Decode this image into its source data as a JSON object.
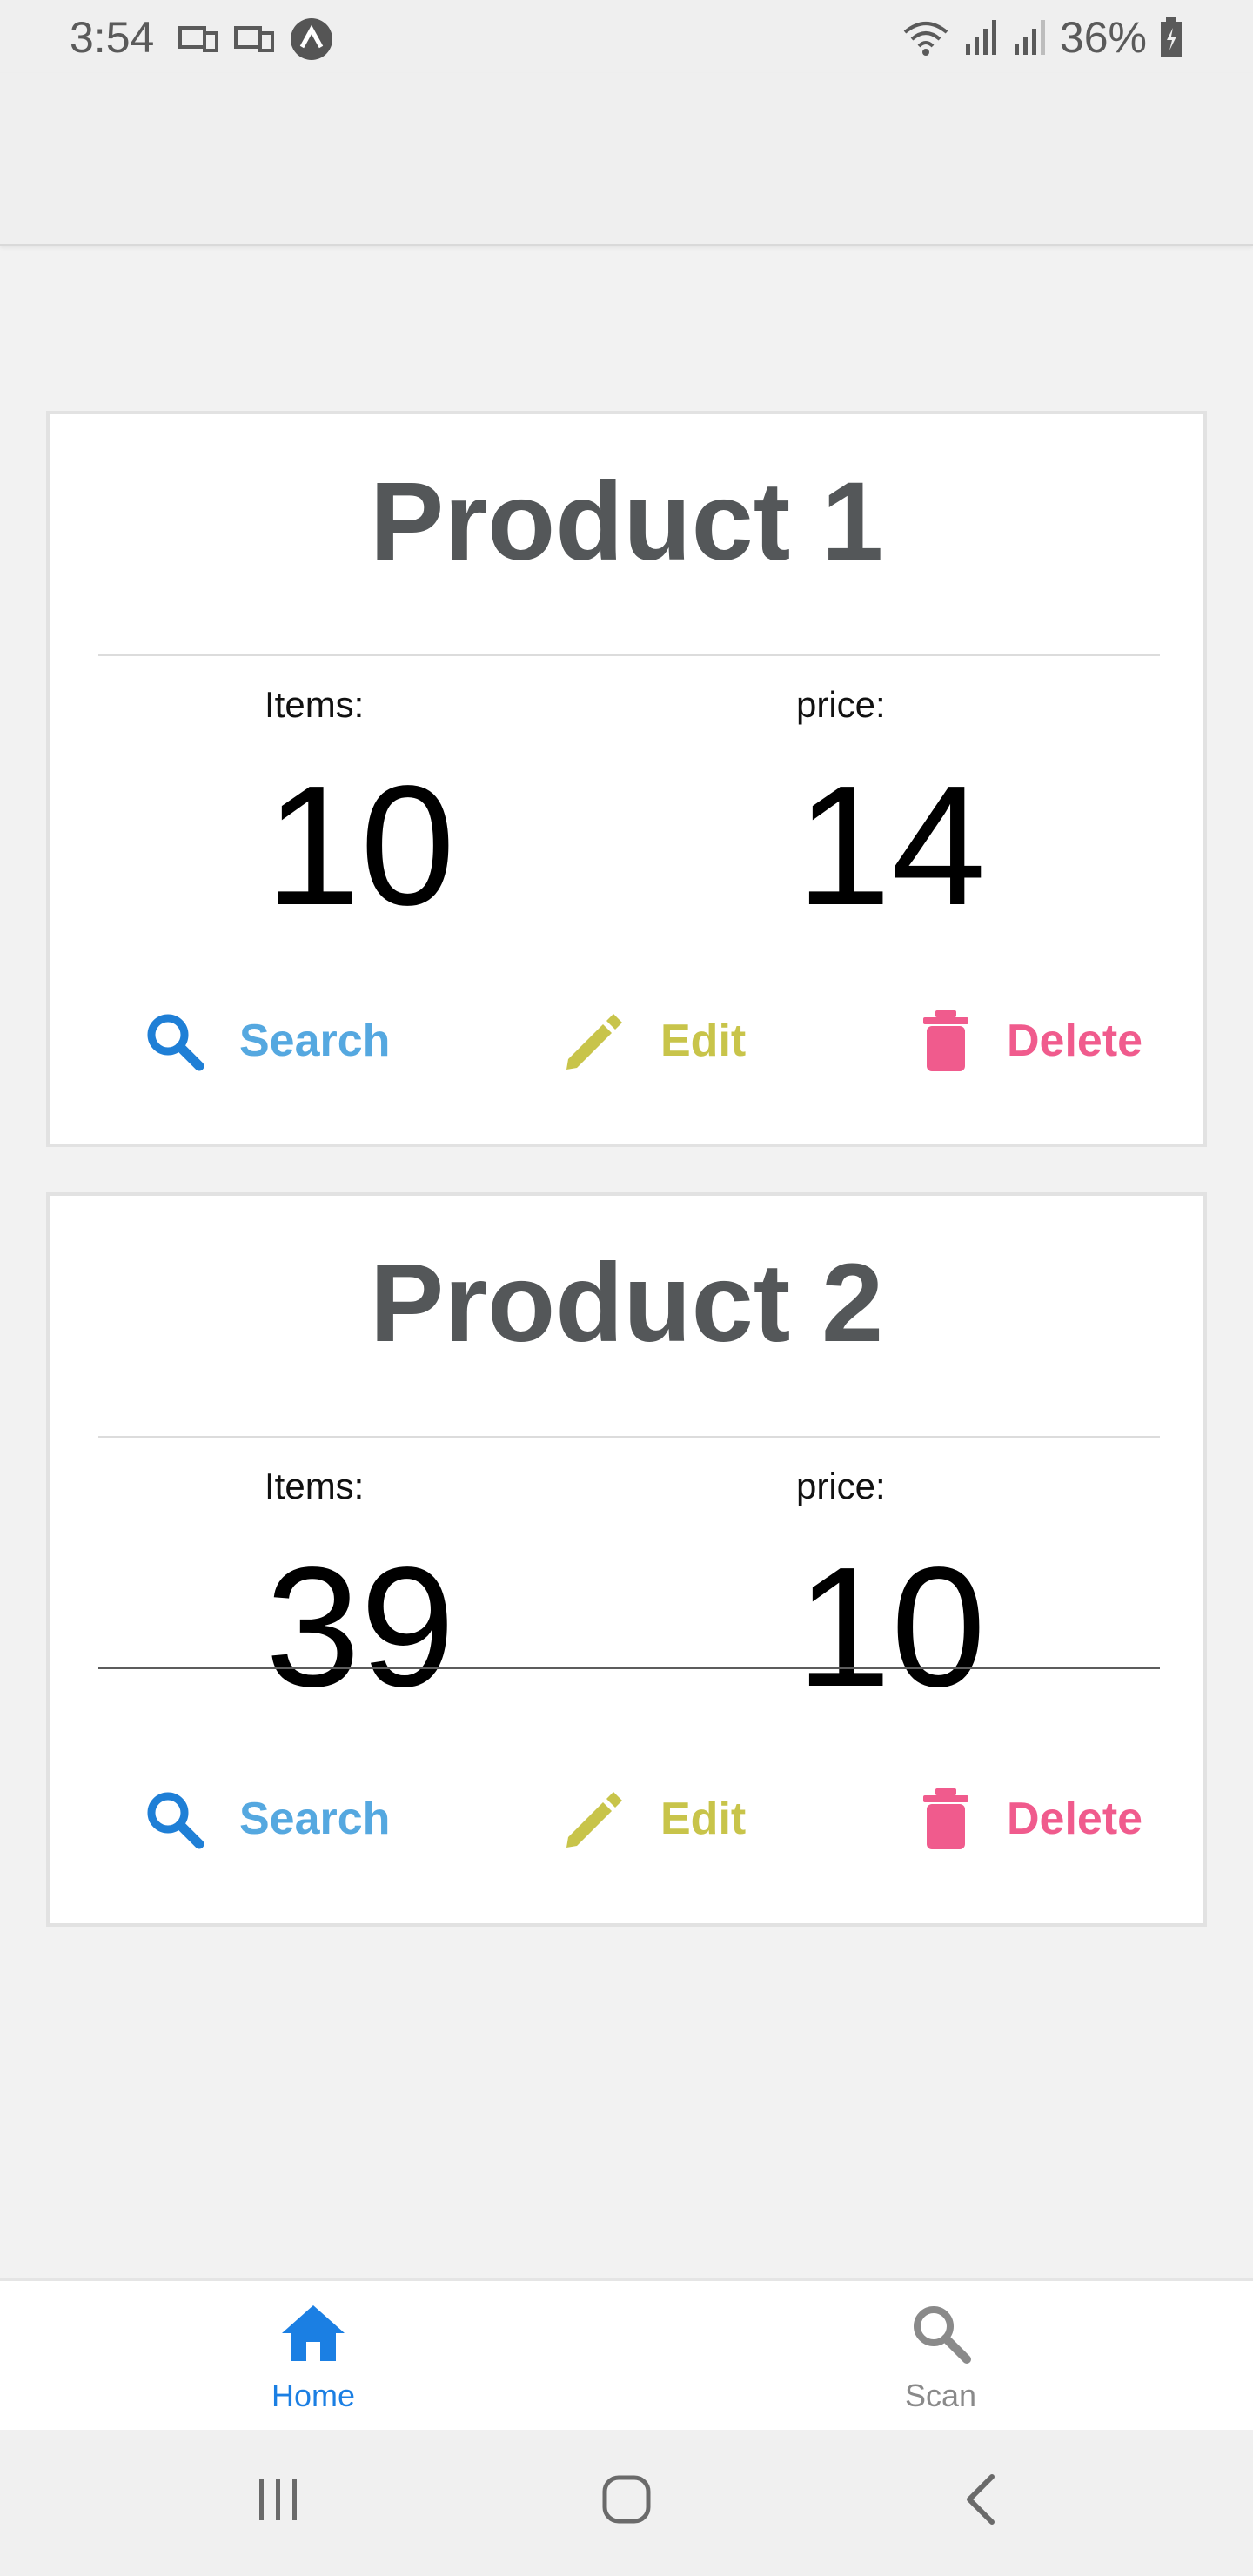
{
  "status_bar": {
    "time": "3:54",
    "battery_percent": "36%",
    "icons": [
      "cast-icon",
      "cast-icon",
      "app-icon",
      "wifi-icon",
      "signal-icon",
      "signal-icon",
      "battery-icon"
    ]
  },
  "products": [
    {
      "title": "Product 1",
      "items_label": "Items:",
      "items_value": "10",
      "price_label": "price:",
      "price_value": "14",
      "actions": {
        "search": "Search",
        "edit": "Edit",
        "delete": "Delete"
      }
    },
    {
      "title": "Product 2",
      "items_label": "Items:",
      "items_value": "39",
      "price_label": "price:",
      "price_value": "10",
      "actions": {
        "search": "Search",
        "edit": "Edit",
        "delete": "Delete"
      }
    }
  ],
  "tabs": [
    {
      "label": "Home",
      "icon": "home-icon",
      "active": true
    },
    {
      "label": "Scan",
      "icon": "search-icon",
      "active": false
    }
  ],
  "colors": {
    "search": "#55a8e0",
    "edit": "#c8c44a",
    "delete": "#f05b8d",
    "active_tab": "#1b7fe3",
    "inactive_tab": "#8a8a8a"
  }
}
